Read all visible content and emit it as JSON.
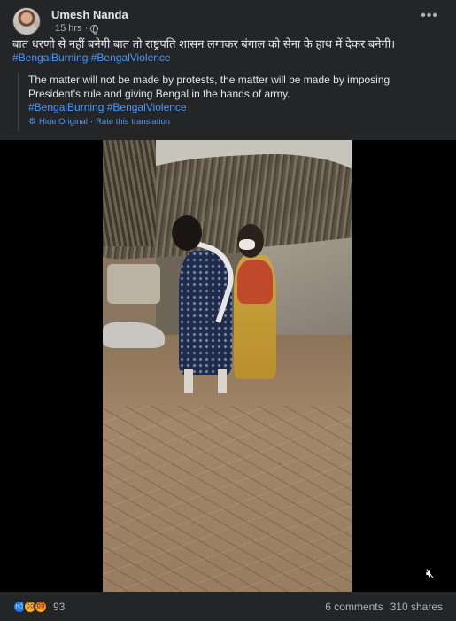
{
  "post": {
    "author": "Umesh Nanda",
    "time": "15 hrs",
    "privacy_icon": "globe-icon",
    "more_icon": "more-options-icon",
    "text_hindi": "बात धरणो से नहीं बनेगी बात तो राष्ट्रपति शासन लगाकर बंगाल को सेना के हाथ में देकर बनेगी।",
    "hashtags": "#BengalBurning #BengalViolence",
    "translation": {
      "text": "The matter will not be made by protests, the matter will be made by imposing President's rule and giving Bengal in the hands of army.",
      "hashtags": "#BengalBurning #BengalViolence",
      "hide_label": "Hide Original",
      "separator": "·",
      "rate_label": "Rate this translation"
    }
  },
  "video": {
    "mute_icon": "speaker-muted-icon"
  },
  "footer": {
    "reaction_icons": [
      "like-icon",
      "sad-icon",
      "angry-icon"
    ],
    "reaction_count": "93",
    "comments": "6 comments",
    "shares": "310 shares"
  },
  "colors": {
    "background": "#242526",
    "link": "#4599ff",
    "text": "#e4e6eb",
    "muted": "#b0b3b8"
  }
}
